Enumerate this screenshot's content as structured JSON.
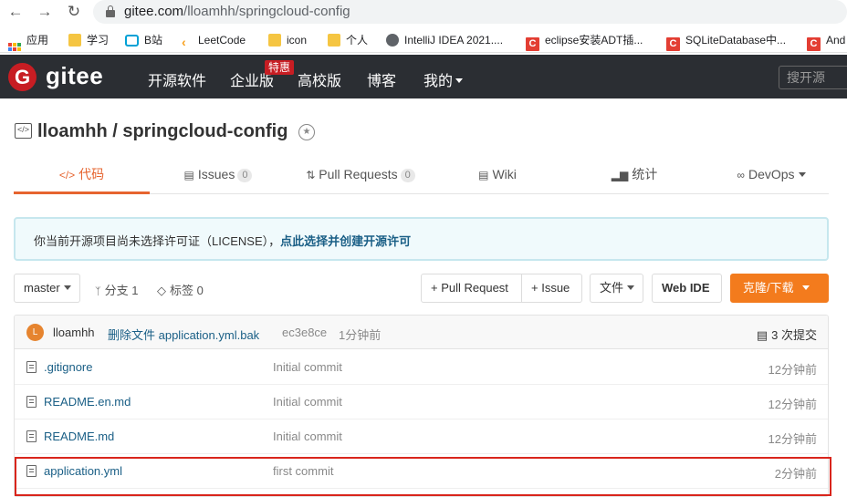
{
  "browser": {
    "url_host": "gitee.com",
    "url_path": "/lloamhh/springcloud-config",
    "bookmarks": [
      {
        "label": "应用",
        "icon": "apps-icon"
      },
      {
        "label": "学习",
        "icon": "folder-icon"
      },
      {
        "label": "B站",
        "icon": "bilibili-icon"
      },
      {
        "label": "LeetCode",
        "icon": "leetcode-icon"
      },
      {
        "label": "icon",
        "icon": "folder-icon"
      },
      {
        "label": "个人",
        "icon": "folder-icon"
      },
      {
        "label": "IntelliJ IDEA 2021....",
        "icon": "globe-icon"
      },
      {
        "label": "eclipse安装ADT插...",
        "icon": "csdn-icon"
      },
      {
        "label": "SQLiteDatabase中...",
        "icon": "csdn-icon"
      },
      {
        "label": "And",
        "icon": "csdn-icon"
      }
    ]
  },
  "header": {
    "brand": "gitee",
    "nav": [
      "开源软件",
      "企业版",
      "高校版",
      "博客",
      "我的"
    ],
    "hot_badge": "特惠",
    "search_placeholder": "搜开源"
  },
  "repo": {
    "title": "lloamhh / springcloud-config",
    "tabs": [
      {
        "label": "代码",
        "active": true
      },
      {
        "label": "Issues",
        "count": "0"
      },
      {
        "label": "Pull Requests",
        "count": "0"
      },
      {
        "label": "Wiki"
      },
      {
        "label": "统计"
      },
      {
        "label": "DevOps"
      }
    ],
    "license_notice": "你当前开源项目尚未选择许可证（LICENSE），",
    "license_link": "点此选择并创建开源许可"
  },
  "toolbar": {
    "branch": "master",
    "branches": "分支 1",
    "tags": "标签 0",
    "pull_request": "+ Pull Request",
    "issue": "+ Issue",
    "file": "文件",
    "web_ide": "Web IDE",
    "clone": "克隆/下载"
  },
  "latest_commit": {
    "avatar_letter": "L",
    "author": "lloamhh",
    "message": "删除文件 application.yml.bak",
    "hash": "ec3e8ce",
    "time": "1分钟前",
    "commits": "3 次提交"
  },
  "files": [
    {
      "name": ".gitignore",
      "message": "Initial commit",
      "time": "12分钟前"
    },
    {
      "name": "README.en.md",
      "message": "Initial commit",
      "time": "12分钟前"
    },
    {
      "name": "README.md",
      "message": "Initial commit",
      "time": "12分钟前"
    },
    {
      "name": "application.yml",
      "message": "first commit",
      "time": "2分钟前"
    }
  ],
  "colors": {
    "header_bg": "#2b2e33",
    "brand_red": "#c71d23",
    "accent_orange": "#e6642f",
    "highlight_red": "#d9251c",
    "link_blue": "#1a5f86"
  }
}
